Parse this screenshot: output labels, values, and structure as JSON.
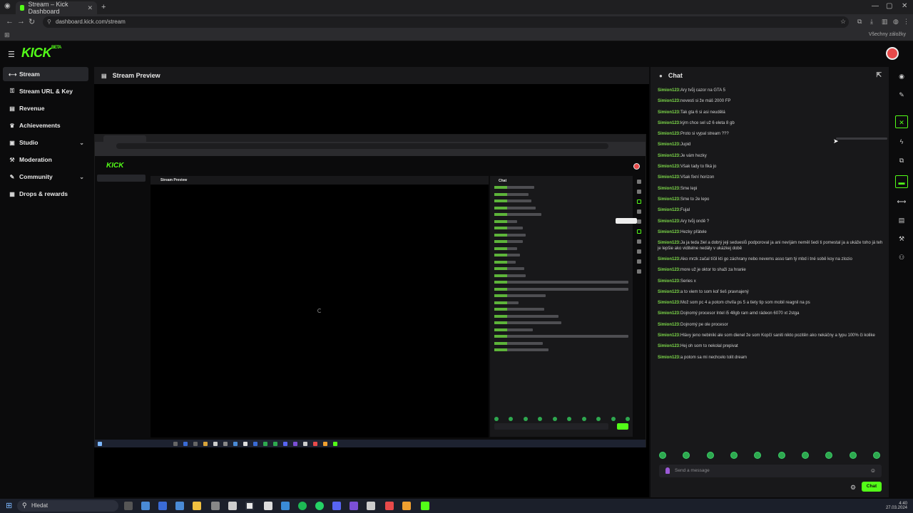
{
  "browser": {
    "tab_title": "Stream – Kick Dashboard",
    "new_tab": "+",
    "url": "dashboard.kick.com/stream",
    "all_bookmarks": "Všechny záložky"
  },
  "header": {
    "logo": "KICK",
    "logo_suffix": "BETA"
  },
  "sidebar": {
    "items": [
      {
        "icon": "stream-icon",
        "label": "Stream"
      },
      {
        "icon": "key-icon",
        "label": "Stream URL & Key"
      },
      {
        "icon": "revenue-icon",
        "label": "Revenue"
      },
      {
        "icon": "trophy-icon",
        "label": "Achievements"
      },
      {
        "icon": "studio-icon",
        "label": "Studio"
      },
      {
        "icon": "moderation-icon",
        "label": "Moderation"
      },
      {
        "icon": "community-icon",
        "label": "Community"
      },
      {
        "icon": "gift-icon",
        "label": "Drops & rewards"
      }
    ]
  },
  "preview": {
    "title": "Stream Preview"
  },
  "chat": {
    "title": "Chat",
    "user": "Simion123:",
    "messages": [
      "Ary tvůj cazor na GTA 5",
      "nevesti si že máš 2000 FP",
      "Tak gta 6 si asi neudělá",
      "kým chce sel už 6 eleta 8 gb",
      "Proto si vypal stream ???",
      "Jupid",
      "Je vám hezky",
      "Však tady to fiká jo",
      "Však fixní horizon",
      "Sme lepi",
      "Sme to 2e lepo",
      "Fujal",
      "Ary tvůj ondě ?",
      "Hezky přátele",
      "Ja ja teda žiel a dobrý jeji sedueslů podporoval ja ani nevíjám neměl šedi ti pomestal ja a ukáže toho já teh je lepšie ako viditelne nedály v ukázkej době",
      "Ako mrzk začal tíčil kti go záchrany nebo nevems asso tam tý mbd i tné sobě koy na zlozio",
      "more už je oktor to shaži za hranie",
      "Series x",
      "a to viem to som koľ tieš pravnajený",
      "Mož som pc 4 a potom chvíla ps 5 a tiety tip som mobil reagnil na ps",
      "Dojnomý procesor Intel i5 48gb ram amd rádeon 6070 xt 2stga",
      "Dojnomý pe ole procesor",
      "Hlávy jeno nebiniki ale som dienel že som Kopčí saniti nikto pozitěn ako nekáčny a typu 100% či kolike",
      "Hej oh som to nekolal prepivat",
      "a potom sa mi nechcelo tolit dream"
    ],
    "input_placeholder": "Send a message",
    "send_label": "Chat"
  },
  "taskbar": {
    "search_placeholder": "Hledat",
    "time": "4:40",
    "date": "27.03.2024"
  },
  "colors": {
    "brand": "#53fc18",
    "panel": "#18181a",
    "background": "#0b0b0c"
  }
}
